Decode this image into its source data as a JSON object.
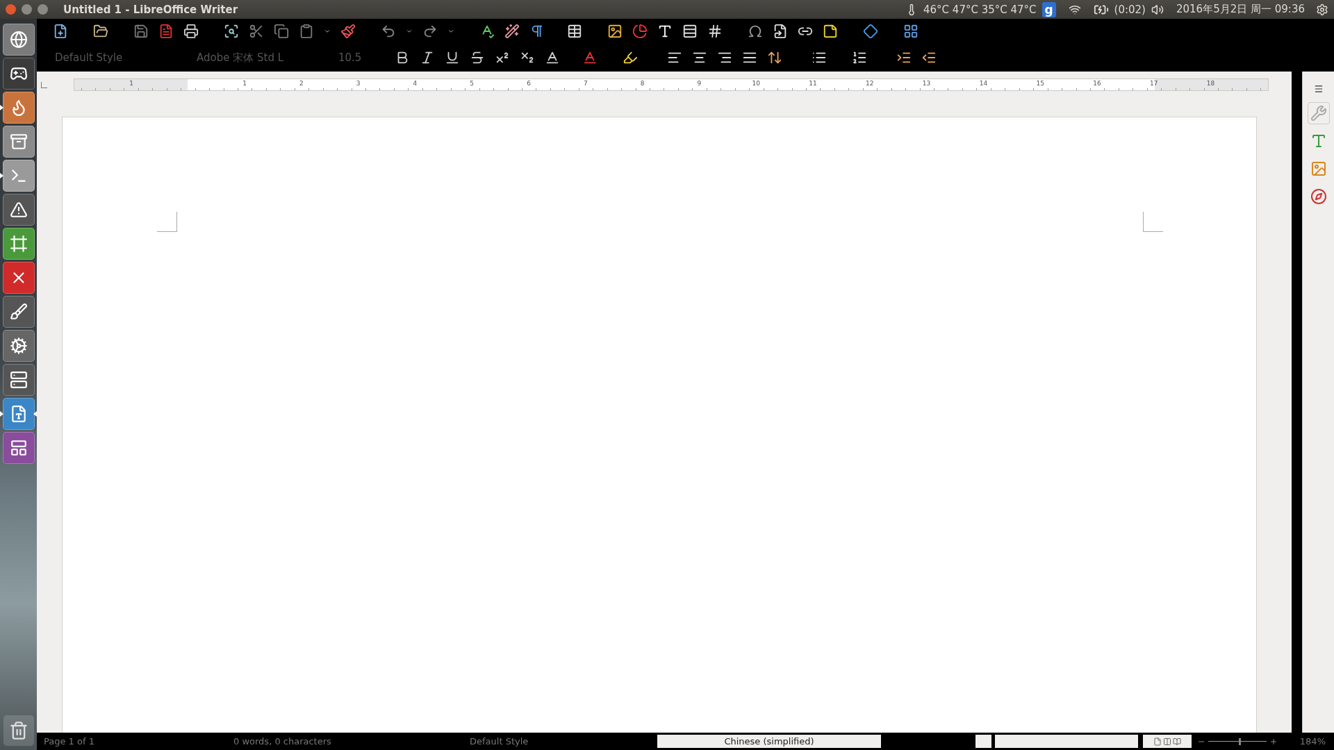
{
  "window": {
    "title": "Untitled 1 - LibreOffice Writer"
  },
  "panel": {
    "temperatures": "46°C 47°C 35°C 47°C",
    "app_letter": "g",
    "battery": "(0:02)",
    "clock": "2016年5月2日 周一 09:36"
  },
  "launcher": [
    {
      "kind": "ubuntu",
      "running": false,
      "active": false
    },
    {
      "kind": "game",
      "running": false,
      "active": false
    },
    {
      "kind": "firefox",
      "running": true,
      "active": false
    },
    {
      "kind": "files",
      "running": false,
      "active": false
    },
    {
      "kind": "terminal",
      "running": true,
      "active": false
    },
    {
      "kind": "vlc",
      "running": false,
      "active": false
    },
    {
      "kind": "qt",
      "running": false,
      "active": false
    },
    {
      "kind": "xmind",
      "running": false,
      "active": false
    },
    {
      "kind": "gimp",
      "running": false,
      "active": false
    },
    {
      "kind": "settings",
      "running": false,
      "active": false
    },
    {
      "kind": "vm",
      "running": false,
      "active": false
    },
    {
      "kind": "writer",
      "running": true,
      "active": true
    },
    {
      "kind": "app",
      "running": false,
      "active": false
    }
  ],
  "formatting": {
    "paragraph_style": "Default Style",
    "font_name": "Adobe 宋体 Std L",
    "font_size": "10.5",
    "disabled": true
  },
  "ruler": {
    "left_labels": [
      "1"
    ],
    "labels": [
      "1",
      "2",
      "3",
      "4",
      "5",
      "6",
      "7",
      "8",
      "9",
      "10",
      "11",
      "12",
      "13",
      "14",
      "15",
      "16",
      "17",
      "18"
    ]
  },
  "status_bar": {
    "page": "Page 1 of 1",
    "words": "0 words, 0 characters",
    "page_style": "Default Style",
    "language": "Chinese (simplified)",
    "zoom": "184%",
    "zoom_slider": {
      "level": 0.53
    }
  }
}
